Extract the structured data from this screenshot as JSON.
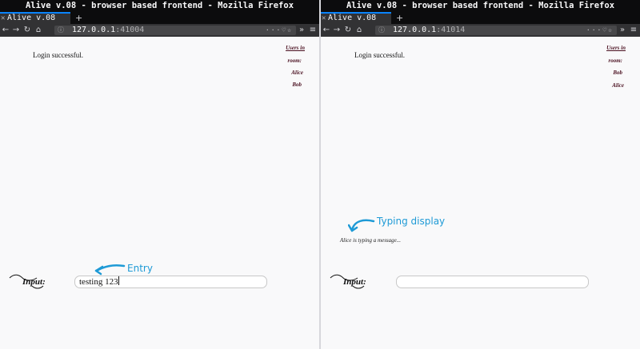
{
  "window_title": "Alive v.08 - browser based frontend - Mozilla Firefox",
  "tab_label": "Alive v.08",
  "left": {
    "url_host": "127.0.0.1",
    "url_port": ":41004",
    "status": "Login successful.",
    "users_title_1": "Users in",
    "users_title_2": "room:",
    "users": [
      "Alice",
      "Bob"
    ],
    "input_label": "Input:",
    "entry_value": "testing 123",
    "annotation": "Entry"
  },
  "right": {
    "url_host": "127.0.0.1",
    "url_port": ":41014",
    "status": "Login successful.",
    "users_title_1": "Users in",
    "users_title_2": "room:",
    "users": [
      "Bob",
      "Alice"
    ],
    "typing_text": "Alice is typing a message...",
    "input_label": "Input:",
    "entry_value": "",
    "annotation": "Typing display"
  },
  "colors": {
    "accent": "#0a84ff",
    "annotation": "#1e9ad6",
    "username": "#4a1020"
  },
  "icons": [
    "close-icon",
    "new-tab-icon",
    "back-icon",
    "forward-icon",
    "reload-icon",
    "home-icon",
    "site-info-icon",
    "page-actions-icon",
    "overflow-icon",
    "menu-icon",
    "arrow-icon"
  ]
}
